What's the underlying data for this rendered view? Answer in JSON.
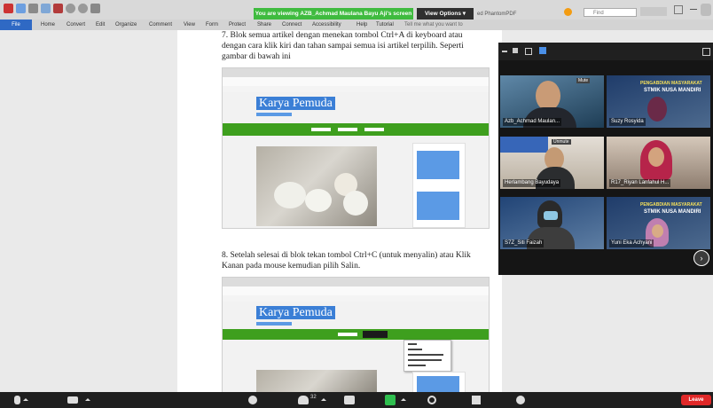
{
  "titlebar": {
    "share_banner": "You are viewing AZB_Achmad Maulana Bayu Aji's screen",
    "view_options": "View Options ▾",
    "app_title": "ed PhantomPDF",
    "find_placeholder": "Find"
  },
  "menubar": {
    "file": "File",
    "items": [
      "Home",
      "Convert",
      "Edit",
      "Organize",
      "Comment",
      "View",
      "Form",
      "Protect",
      "Share",
      "Connect",
      "Accessibility",
      "Help",
      "Tutorial"
    ],
    "tell_me": "Tell me what you want to"
  },
  "document": {
    "step7_partial": "7.     Blok semua artikel dengan menekan tombol Ctrl+A di keyboard atau",
    "step7_line2": "dengan cara klik kiri dan tahan sampai semua isi artikel terpilih. Seperti",
    "step7_line3": "gambar di bawah ini",
    "step8_line1": "8.     Setelah selesai di blok tekan tombol Ctrl+C (untuk menyalin) atau Klik",
    "step8_line2": "Kanan pada mouse kemudian pilih Salin.",
    "site_title": "Karya Pemuda"
  },
  "video_panel": {
    "participants": [
      {
        "name": "Azb_Achmad Maulan..."
      },
      {
        "name": "Suzy Rosyida"
      },
      {
        "name": "Herlambang Bayudaya"
      },
      {
        "name": "R17_Riyan Lanfahul H..."
      },
      {
        "name": "S7Z_Siti Faizah"
      },
      {
        "name": "Yuni Eka Achyani"
      }
    ],
    "tile_banner": "PENGABDIAN MASYARAKAT",
    "tile_school": "STMIK NUSA MANDIRI",
    "mute_label": "Mute",
    "unmute_label": "Unmute"
  },
  "toolbar": {
    "participants_count": "32",
    "leave": "Leave"
  },
  "colors": {
    "share_green": "#3fbb3f",
    "file_blue": "#2f69c4",
    "leave_red": "#e02828",
    "site_green": "#3e9f1e"
  }
}
